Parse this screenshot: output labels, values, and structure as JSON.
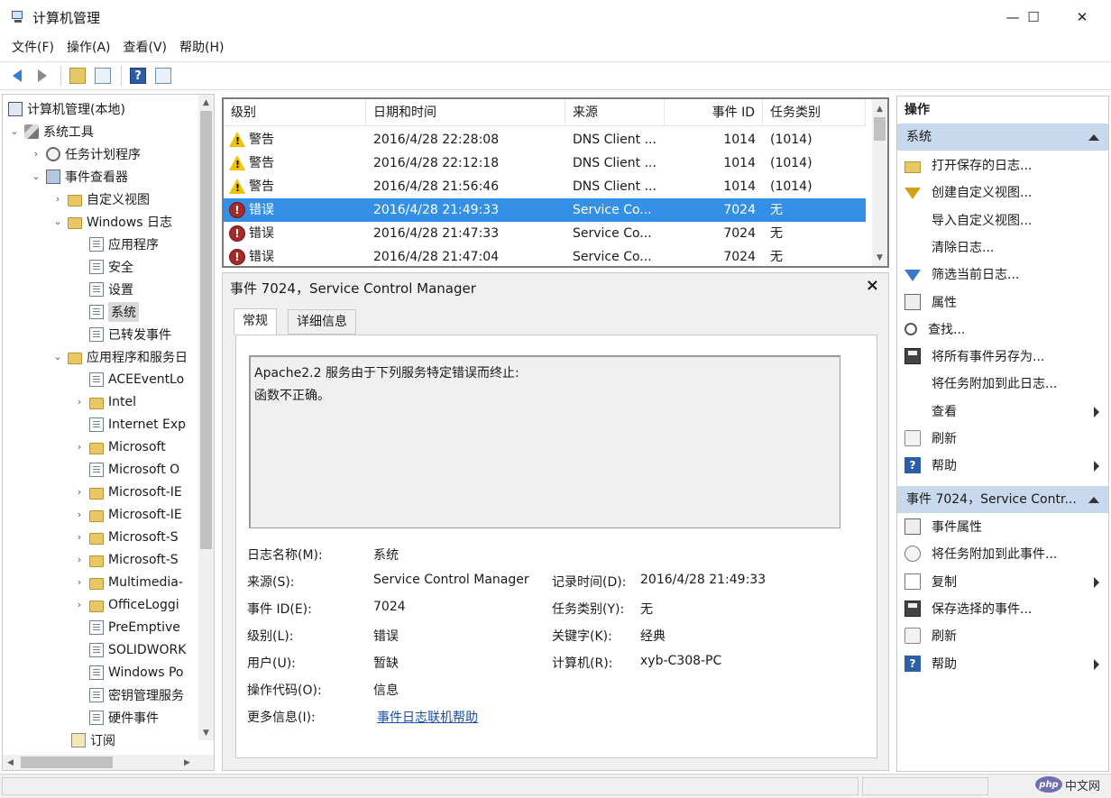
{
  "window": {
    "title": "计算机管理",
    "controls": [
      "—",
      "☐",
      "✕"
    ]
  },
  "menubar": [
    "文件(F)",
    "操作(A)",
    "查看(V)",
    "帮助(H)"
  ],
  "toolbar": {
    "icons": [
      "back-arrow-icon",
      "forward-arrow-icon",
      "up-folder-icon",
      "show-hide-tree-icon",
      "help-icon",
      "show-hide-action-pane-icon"
    ],
    "help_glyph": "?"
  },
  "tree": {
    "root": "计算机管理(本地)",
    "system_tools": "系统工具",
    "task_scheduler": "任务计划程序",
    "event_viewer": "事件查看器",
    "custom_views": "自定义视图",
    "windows_logs": "Windows 日志",
    "windows_log_items": [
      "应用程序",
      "安全",
      "设置",
      "系统",
      "已转发事件"
    ],
    "app_service_logs": "应用程序和服务日",
    "app_service_items": [
      {
        "label": "ACEEventLo",
        "expandable": false
      },
      {
        "label": "Intel",
        "expandable": true
      },
      {
        "label": "Internet Exp",
        "expandable": false
      },
      {
        "label": "Microsoft",
        "expandable": true
      },
      {
        "label": "Microsoft O",
        "expandable": false
      },
      {
        "label": "Microsoft-IE",
        "expandable": true
      },
      {
        "label": "Microsoft-IE",
        "expandable": true
      },
      {
        "label": "Microsoft-S",
        "expandable": true
      },
      {
        "label": "Microsoft-S",
        "expandable": true
      },
      {
        "label": "Multimedia-",
        "expandable": true
      },
      {
        "label": "OfficeLoggi",
        "expandable": true
      },
      {
        "label": "PreEmptive",
        "expandable": false
      },
      {
        "label": "SOLIDWORK",
        "expandable": false
      },
      {
        "label": "Windows Po",
        "expandable": false
      },
      {
        "label": "密钥管理服务",
        "expandable": false
      },
      {
        "label": "硬件事件",
        "expandable": false
      }
    ],
    "subscriptions": "订阅",
    "selected": "系统"
  },
  "events": {
    "columns": [
      "级别",
      "日期和时间",
      "来源",
      "事件 ID",
      "任务类别"
    ],
    "rows": [
      {
        "level": "警告",
        "type": "warning",
        "datetime": "2016/4/28 22:28:08",
        "source": "DNS Client ...",
        "id": "1014",
        "category": "(1014)"
      },
      {
        "level": "警告",
        "type": "warning",
        "datetime": "2016/4/28 22:12:18",
        "source": "DNS Client ...",
        "id": "1014",
        "category": "(1014)"
      },
      {
        "level": "警告",
        "type": "warning",
        "datetime": "2016/4/28 21:56:46",
        "source": "DNS Client ...",
        "id": "1014",
        "category": "(1014)"
      },
      {
        "level": "错误",
        "type": "error",
        "datetime": "2016/4/28 21:49:33",
        "source": "Service Co...",
        "id": "7024",
        "category": "无",
        "selected": true
      },
      {
        "level": "错误",
        "type": "error",
        "datetime": "2016/4/28 21:47:33",
        "source": "Service Co...",
        "id": "7024",
        "category": "无"
      },
      {
        "level": "错误",
        "type": "error",
        "datetime": "2016/4/28 21:47:04",
        "source": "Service Co...",
        "id": "7024",
        "category": "无"
      }
    ]
  },
  "detail": {
    "title": "事件 7024，Service Control Manager",
    "close": "×",
    "tabs": [
      "常规",
      "详细信息"
    ],
    "description_lines": [
      "Apache2.2 服务由于下列服务特定错误而终止:",
      "函数不正确。"
    ],
    "log_name_label": "日志名称(M):",
    "log_name": "系统",
    "source_label": "来源(S):",
    "source": "Service Control Manager",
    "logged_label": "记录时间(D):",
    "logged": "2016/4/28 21:49:33",
    "event_id_label": "事件 ID(E):",
    "event_id": "7024",
    "task_category_label": "任务类别(Y):",
    "task_category": "无",
    "level_label": "级别(L):",
    "level": "错误",
    "keywords_label": "关键字(K):",
    "keywords": "经典",
    "user_label": "用户(U):",
    "user": "暂缺",
    "computer_label": "计算机(R):",
    "computer": "xyb-C308-PC",
    "opcode_label": "操作代码(O):",
    "opcode": "信息",
    "more_info_label": "更多信息(I):",
    "more_info_link": "事件日志联机帮助"
  },
  "actions": {
    "title": "操作",
    "section1": "系统",
    "section1_items": [
      {
        "label": "打开保存的日志...",
        "icon": "open-folder-icon"
      },
      {
        "label": "创建自定义视图...",
        "icon": "filter-create-icon"
      },
      {
        "label": "导入自定义视图...",
        "icon": ""
      },
      {
        "label": "清除日志...",
        "icon": ""
      },
      {
        "label": "筛选当前日志...",
        "icon": "filter-icon"
      },
      {
        "label": "属性",
        "icon": "properties-icon"
      },
      {
        "label": "查找...",
        "icon": "find-icon"
      },
      {
        "label": "将所有事件另存为...",
        "icon": "save-icon"
      },
      {
        "label": "将任务附加到此日志...",
        "icon": ""
      },
      {
        "label": "查看",
        "icon": "",
        "submenu": true
      },
      {
        "label": "刷新",
        "icon": "refresh-icon"
      },
      {
        "label": "帮助",
        "icon": "help-icon",
        "submenu": true
      }
    ],
    "section2": "事件 7024，Service Contr...",
    "section2_items": [
      {
        "label": "事件属性",
        "icon": "event-properties-icon"
      },
      {
        "label": "将任务附加到此事件...",
        "icon": "attach-task-icon"
      },
      {
        "label": "复制",
        "icon": "copy-icon",
        "submenu": true
      },
      {
        "label": "保存选择的事件...",
        "icon": "save-icon"
      },
      {
        "label": "刷新",
        "icon": "refresh-icon"
      },
      {
        "label": "帮助",
        "icon": "help-icon",
        "submenu": true
      }
    ]
  },
  "watermark": {
    "badge": "php",
    "text": "中文网"
  },
  "colors": {
    "selection": "#3390e6",
    "section_header": "#c8d9ee",
    "link": "#1a4fa8",
    "error": "#a52a2a",
    "warning": "#f2c200"
  }
}
